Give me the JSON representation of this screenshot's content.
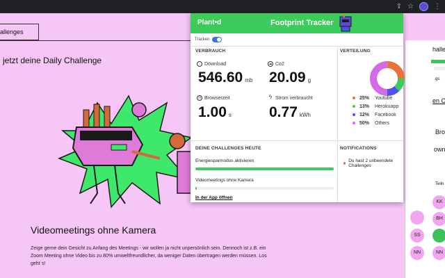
{
  "background_page": {
    "nav_label": "allenges",
    "heading": "jetzt deine Daily Challenge",
    "card_title": "Videomeetings ohne Kamera",
    "card_text": "Zeige gerne dein Gesicht zu Anfang des Meetings - wir wollen ja nicht unpersönlich sein. Dennoch ist z.B. ein Zoom Meeting ohne Video bis zu 80% umweltfreundlicher, da weniger Daten übertragen werden müssen. Los geht´s!",
    "right_column": {
      "texts": [
        "halle",
        "gs",
        "en Ch",
        "Bro",
        "ownl",
        "Teiln"
      ],
      "avatars": [
        "KK",
        "BH",
        "SS",
        "NN",
        "NN"
      ]
    }
  },
  "popup": {
    "brand": "Plant•d",
    "title": "Footprint Tracker",
    "tracking_label": "Tracken",
    "tracking_on": true,
    "consumption": {
      "title": "VERBRAUCH",
      "metrics": [
        {
          "label": "Download",
          "value": "546.60",
          "unit": "mb",
          "icon": "download-icon"
        },
        {
          "label": "Co2",
          "value": "20.09",
          "unit": "g",
          "icon": "cloud-icon"
        },
        {
          "label": "Browserzeit",
          "value": "1.00",
          "unit": "s",
          "icon": "clock-icon"
        },
        {
          "label": "Strom verbraucht",
          "value": "0.77",
          "unit": "kWh",
          "icon": "lightning-icon"
        }
      ]
    },
    "distribution": {
      "title": "VERTEILUNG",
      "segments": [
        {
          "pct": "25%",
          "name": "Youtube",
          "value": 25,
          "color": "#e8733a"
        },
        {
          "pct": "13%",
          "name": "Herokuapp",
          "value": 13,
          "color": "#3dcb5c"
        },
        {
          "pct": "12%",
          "name": "Facebook",
          "value": 12,
          "color": "#4a55e6"
        },
        {
          "pct": "50%",
          "name": "Others",
          "value": 50,
          "color": "#d36ae6"
        }
      ]
    },
    "challenges": {
      "title": "DEINE CHALLENGES HEUTE",
      "items": [
        {
          "label": "Energiesparmodus aktivieren",
          "progress": 100
        },
        {
          "label": "Videomeetings ohne Kamera",
          "progress": 1
        }
      ],
      "app_link": "In der App öffnen"
    },
    "notifications": {
      "title": "NOTIFICATIONS",
      "items": [
        "Du hast 2 unbeendete Challenges"
      ]
    }
  }
}
